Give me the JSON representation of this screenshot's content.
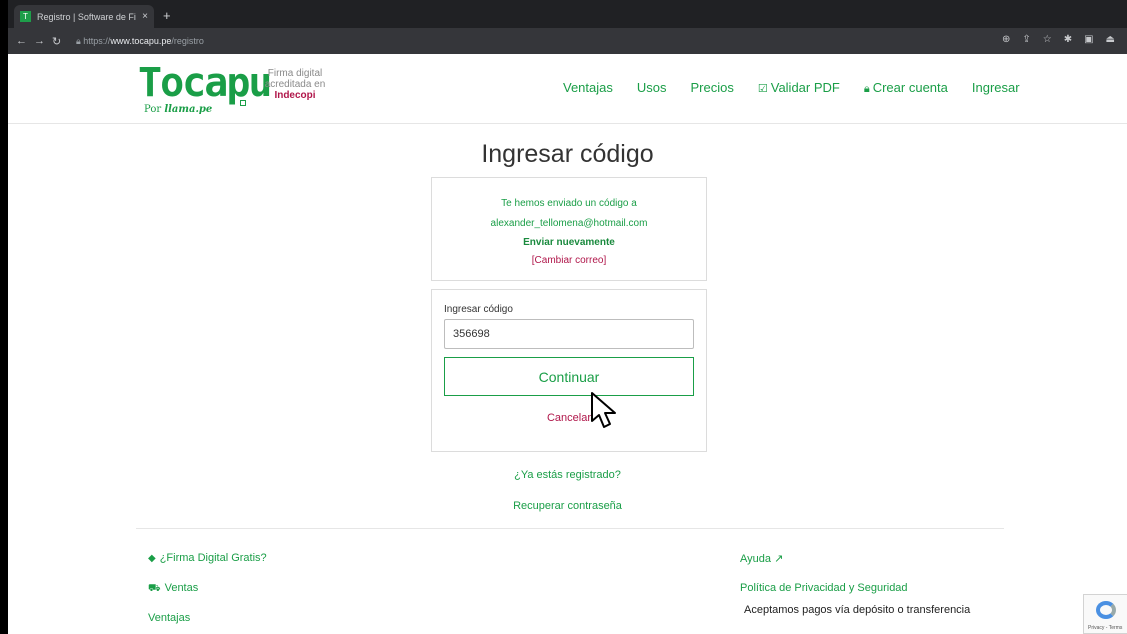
{
  "browser": {
    "tab_title": "Registro | Software de Firma D",
    "tab_close": "×",
    "new_tab": "+",
    "url_prefix": "https://",
    "url_host": "www.tocapu.pe",
    "url_path": "/registro"
  },
  "header": {
    "logo_word": "Tocapu",
    "logo_by": "Por",
    "logo_brand": "llama.pe",
    "acred_line1": "Firma digital",
    "acred_line2": "acreditada en",
    "acred_source": "Indecopi",
    "nav": [
      {
        "label": "Ventajas",
        "icon": ""
      },
      {
        "label": "Usos",
        "icon": ""
      },
      {
        "label": "Precios",
        "icon": ""
      },
      {
        "label": "Validar PDF",
        "icon": "check-square-icon"
      },
      {
        "label": "Crear cuenta",
        "icon": "lock-icon"
      },
      {
        "label": "Ingresar",
        "icon": ""
      }
    ]
  },
  "main": {
    "title": "Ingresar código",
    "notice_line1": "Te hemos enviado un código a",
    "notice_email": "alexander_tellomena@hotmail.com",
    "resend": "Enviar nuevamente",
    "change_email": "[Cambiar correo]",
    "code_label": "Ingresar código",
    "code_value": "356698",
    "continue": "Continuar",
    "cancel": "Cancelar",
    "registered": "¿Ya estás registrado?",
    "recover": "Recuperar contraseña"
  },
  "footer": {
    "free_sig": "¿Firma Digital Gratis?",
    "sales": "Ventas",
    "advantages": "Ventajas",
    "help": "Ayuda",
    "privacy": "Política de Privacidad y Seguridad",
    "payments": "Aceptamos pagos vía depósito o transferencia"
  },
  "recaptcha": {
    "text": "Privacy - Terms"
  },
  "colors": {
    "brand_green": "#1a9e47",
    "accent_red": "#b0164a"
  }
}
